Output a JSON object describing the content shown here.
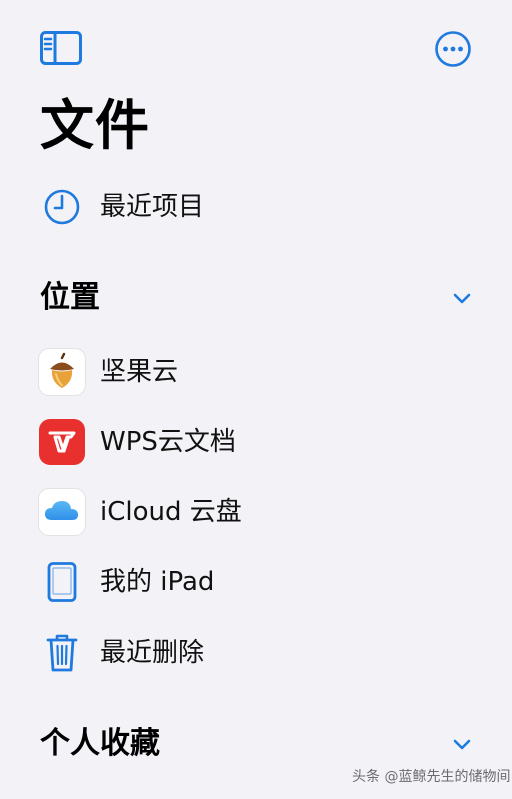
{
  "header": {
    "title": "文件",
    "sidebar_toggle_icon": "sidebar-icon",
    "more_icon": "ellipsis-circle-icon"
  },
  "recents": {
    "label": "最近项目",
    "icon": "clock-icon"
  },
  "locations": {
    "title": "位置",
    "chevron_icon": "chevron-down-icon",
    "items": [
      {
        "label": "坚果云",
        "icon": "acorn-app-icon"
      },
      {
        "label": "WPS云文档",
        "icon": "wps-app-icon"
      },
      {
        "label": "iCloud 云盘",
        "icon": "icloud-icon"
      },
      {
        "label": "我的 iPad",
        "icon": "ipad-icon"
      },
      {
        "label": "最近删除",
        "icon": "trash-icon"
      }
    ]
  },
  "favorites": {
    "title": "个人收藏",
    "chevron_icon": "chevron-down-icon"
  },
  "watermark": "头条 @蓝鲸先生的储物间",
  "colors": {
    "accent": "#1f7ae0",
    "background": "#f2f2f7",
    "wps_red": "#e8312f"
  }
}
